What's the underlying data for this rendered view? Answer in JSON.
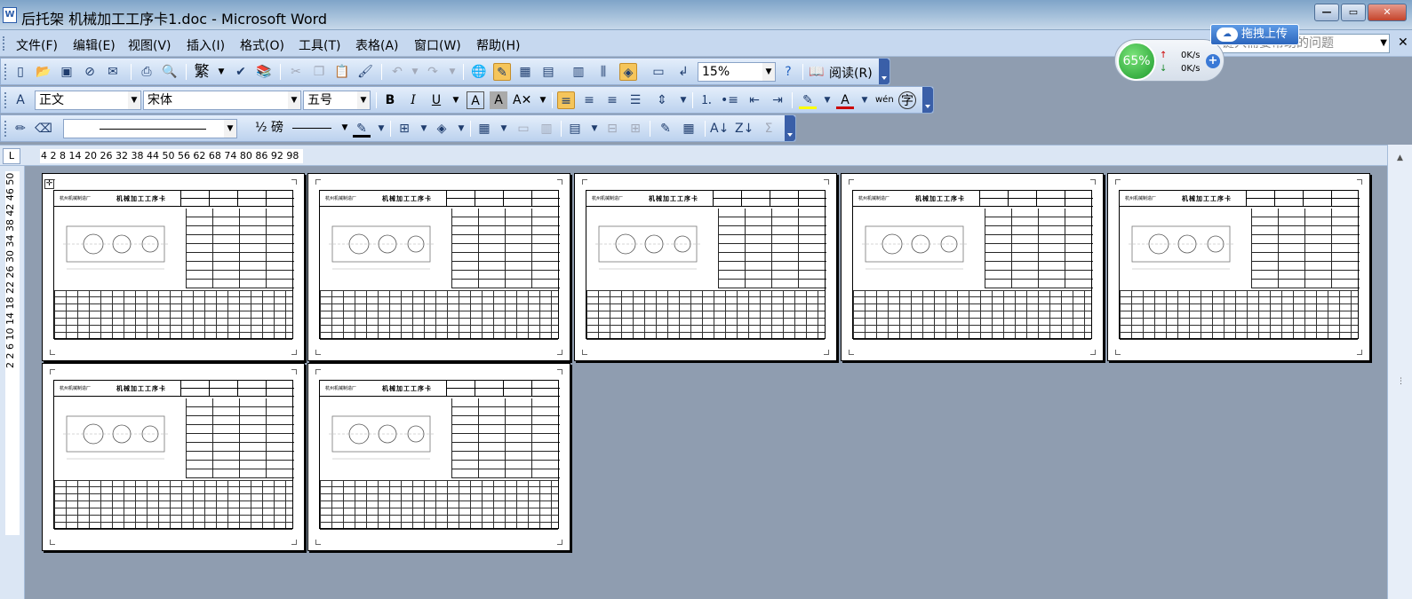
{
  "window": {
    "title": "后托架 机械加工工序卡1.doc - Microsoft Word",
    "app_icon": "W",
    "controls": [
      "minimize-icon",
      "maximize-icon",
      "close-icon"
    ]
  },
  "menu": {
    "items": [
      "文件(F)",
      "编辑(E)",
      "视图(V)",
      "插入(I)",
      "格式(O)",
      "工具(T)",
      "表格(A)",
      "窗口(W)",
      "帮助(H)"
    ],
    "help_placeholder": "键入需要帮助的问题"
  },
  "upload_button": {
    "label": "拖拽上传"
  },
  "net_monitor": {
    "percent": "65%",
    "up": "0K/s",
    "down": "0K/s"
  },
  "toolbar_standard": {
    "zoom": "15%",
    "read_label": "阅读(R)"
  },
  "toolbar_format": {
    "style": "正文",
    "font": "宋体",
    "size": "五号",
    "bold": "B",
    "italic": "I",
    "underline": "U",
    "traditional": "繁",
    "wen": "wén",
    "char": "字"
  },
  "toolbar_tables": {
    "line_weight": "½ 磅",
    "sum": "Σ"
  },
  "ruler": {
    "tab_selector": "L",
    "horizontal": "4 2  8 14 20 26 32 38 44 50 56 62 68 74 80 86 92 98",
    "vertical": "2 2 6 10 14 18 22 26 30 34 38 42 46 50"
  },
  "document": {
    "card_company": "杭州机械制造厂",
    "card_title": "机械加工工序卡",
    "page_count": 7
  },
  "colors": {
    "titlebar": "#a9c3dc",
    "menubar": "#c6d8ef",
    "workspace": "#8f9db0",
    "accent": "#3a5fa8"
  }
}
